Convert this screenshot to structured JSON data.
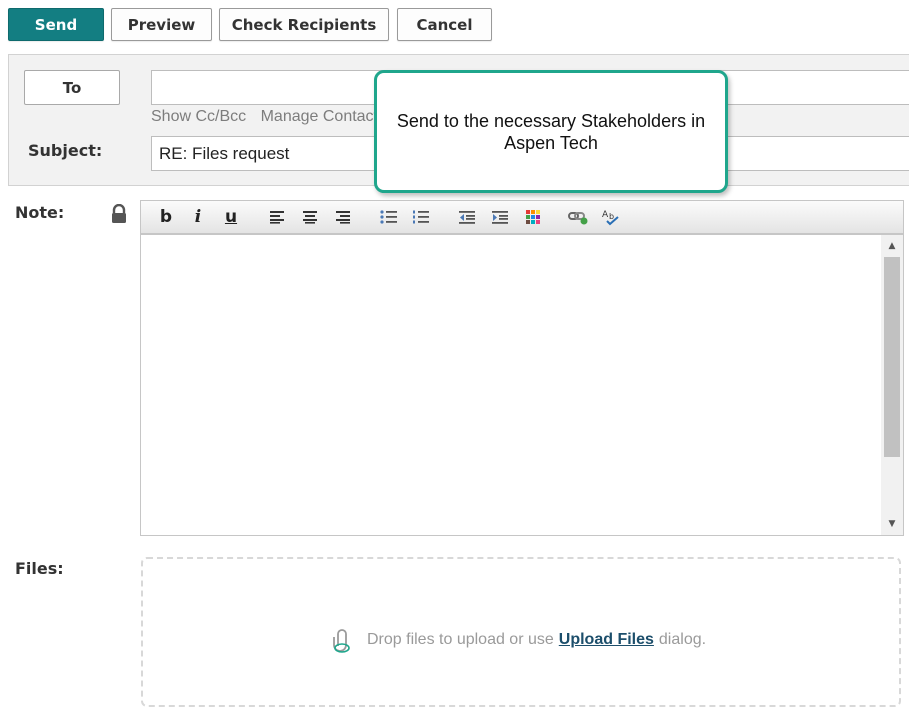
{
  "toolbar": {
    "send_label": "Send",
    "preview_label": "Preview",
    "check_recipients_label": "Check Recipients",
    "cancel_label": "Cancel"
  },
  "recipients": {
    "to_label": "To",
    "to_value": "",
    "show_cc_bcc": "Show Cc/Bcc",
    "manage_contacts": "Manage Contact"
  },
  "subject": {
    "label": "Subject:",
    "value": "RE: Files request"
  },
  "callout": {
    "text": "Send to the necessary Stakeholders in Aspen Tech"
  },
  "note": {
    "label": "Note:",
    "value": "",
    "tools": [
      "bold-icon",
      "italic-icon",
      "underline-icon",
      "align-left-icon",
      "align-center-icon",
      "align-right-icon",
      "bullet-list-icon",
      "numbered-list-icon",
      "outdent-icon",
      "indent-icon",
      "color-palette-icon",
      "link-icon",
      "spell-check-icon"
    ]
  },
  "files": {
    "label": "Files:",
    "drop_text_before": "Drop files to upload or use",
    "upload_link": "Upload Files",
    "drop_text_after": "dialog."
  },
  "colors": {
    "primary": "#137e82",
    "callout_border": "#1fa68c",
    "link": "#1c4e6b"
  }
}
